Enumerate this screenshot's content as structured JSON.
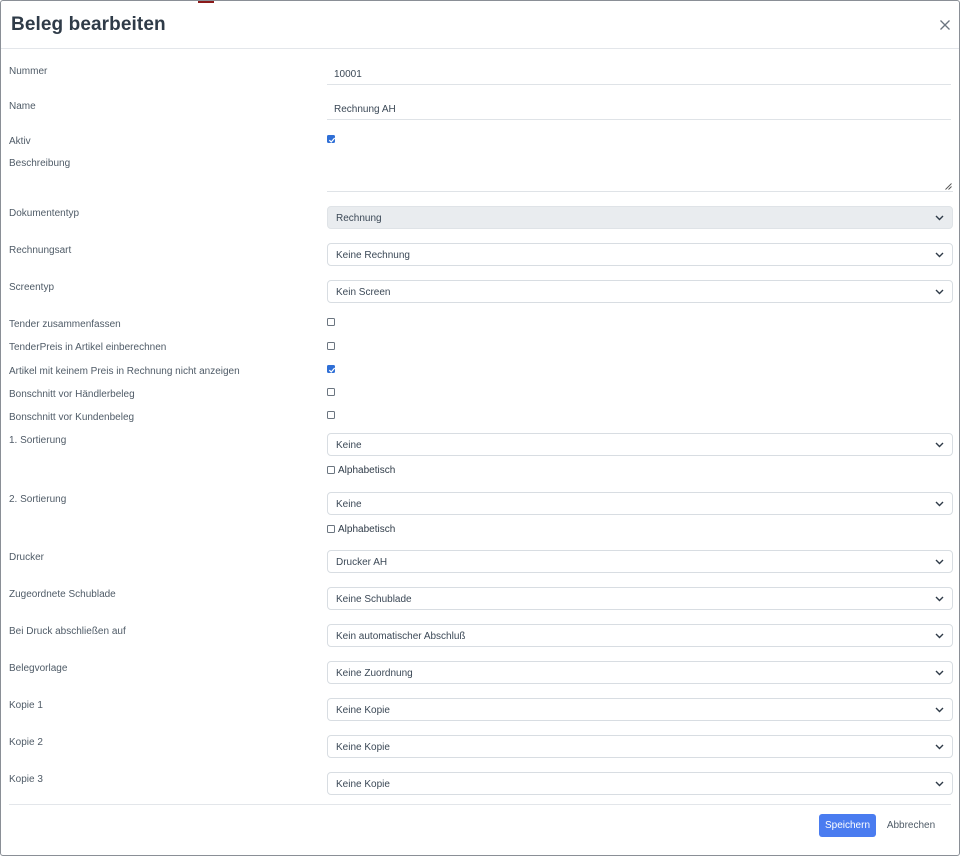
{
  "dialog": {
    "title": "Beleg bearbeiten",
    "close_icon": "close-icon"
  },
  "fields": {
    "nummer": {
      "label": "Nummer",
      "value": "10001"
    },
    "name": {
      "label": "Name",
      "value": "Rechnung AH"
    },
    "aktiv": {
      "label": "Aktiv",
      "checked": true
    },
    "beschreibung": {
      "label": "Beschreibung",
      "value": ""
    },
    "dokumententyp": {
      "label": "Dokumententyp",
      "value": "Rechnung",
      "disabled": true
    },
    "rechnungsart": {
      "label": "Rechnungsart",
      "value": "Keine Rechnung"
    },
    "screentyp": {
      "label": "Screentyp",
      "value": "Kein Screen"
    },
    "tender_zusammenfassen": {
      "label": "Tender zusammenfassen",
      "checked": false
    },
    "tenderpreis": {
      "label": "TenderPreis in Artikel einberechnen",
      "checked": false
    },
    "artikel_kein_preis": {
      "label": "Artikel mit keinem Preis in Rechnung nicht anzeigen",
      "checked": true
    },
    "bonschnitt_haendler": {
      "label": "Bonschnitt vor Händlerbeleg",
      "checked": false
    },
    "bonschnitt_kunde": {
      "label": "Bonschnitt vor Kundenbeleg",
      "checked": false
    },
    "sortierung1": {
      "label": "1. Sortierung",
      "value": "Keine",
      "alpha_label": "Alphabetisch",
      "alpha_checked": false
    },
    "sortierung2": {
      "label": "2. Sortierung",
      "value": "Keine",
      "alpha_label": "Alphabetisch",
      "alpha_checked": false
    },
    "drucker": {
      "label": "Drucker",
      "value": "Drucker AH"
    },
    "schublade": {
      "label": "Zugeordnete Schublade",
      "value": "Keine Schublade"
    },
    "abschluss": {
      "label": "Bei Druck abschließen auf",
      "value": "Kein automatischer Abschluß"
    },
    "belegvorlage": {
      "label": "Belegvorlage",
      "value": "Keine Zuordnung"
    },
    "kopie1": {
      "label": "Kopie 1",
      "value": "Keine Kopie"
    },
    "kopie2": {
      "label": "Kopie 2",
      "value": "Keine Kopie"
    },
    "kopie3": {
      "label": "Kopie 3",
      "value": "Keine Kopie"
    }
  },
  "footer": {
    "save_label": "Speichern",
    "cancel_label": "Abbrechen"
  },
  "colors": {
    "primary": "#4a7cf0",
    "checkbox_checked": "#2f6fd6",
    "disabled_bg": "#e9ecef"
  }
}
